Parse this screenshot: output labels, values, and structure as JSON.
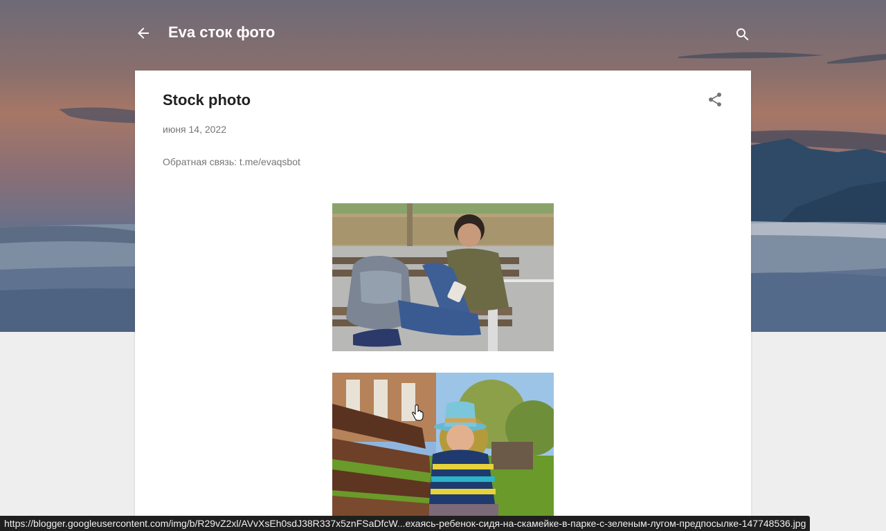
{
  "header": {
    "blog_title": "Eva сток фото",
    "back_icon": "arrow-left-icon",
    "search_icon": "search-icon"
  },
  "post": {
    "title": "Stock photo",
    "date": "июня 14, 2022",
    "feedback_text": "Обратная связь: t.me/evaqsbot",
    "share_icon": "share-icon",
    "images": [
      {
        "name": "boy-on-bench-with-backpack-photo"
      },
      {
        "name": "child-in-hat-on-park-bench-photo"
      }
    ]
  },
  "status_bar": {
    "url": "https://blogger.googleusercontent.com/img/b/R29vZ2xl/AVvXsEh0sdJ38R337x5znFSaDfcW...ехаясь-ребенок-сидя-на-скамейке-в-парке-с-зеленым-лугом-предпосылке-147748536.jpg"
  },
  "colors": {
    "page_background": "#eeeeee",
    "card_background": "#ffffff",
    "title_text": "#212121",
    "meta_text": "#757575",
    "status_bar": "#1f1f1f"
  }
}
